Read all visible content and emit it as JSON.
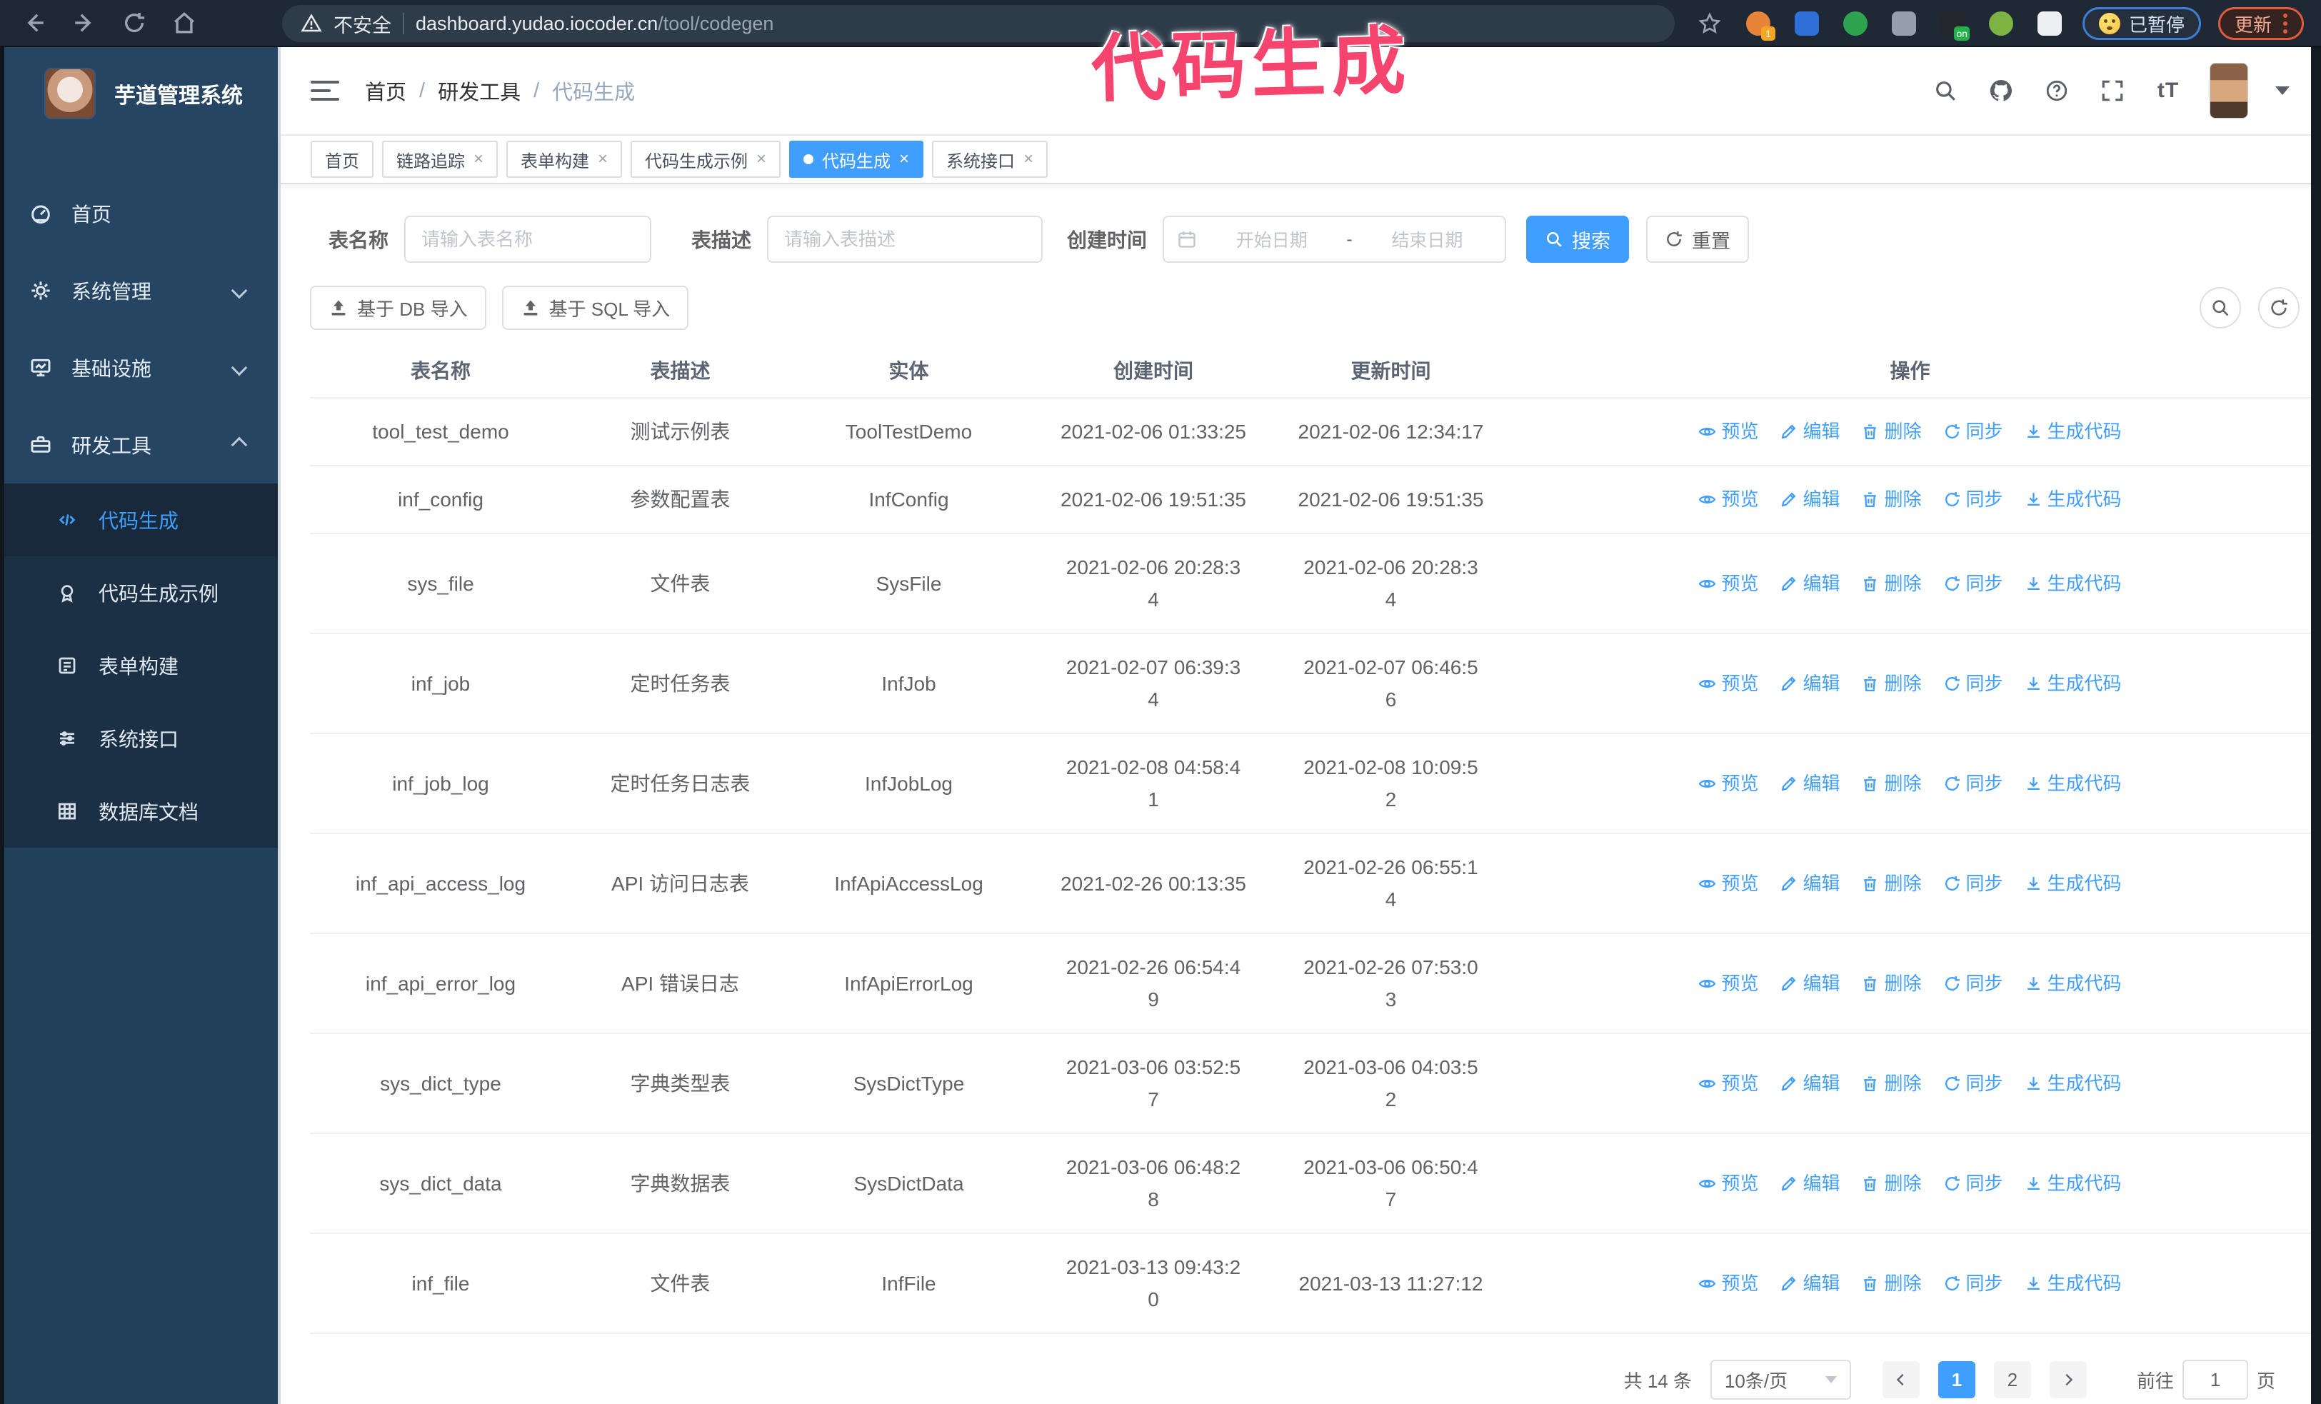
{
  "browser": {
    "insecure_label": "不安全",
    "url_host": "dashboard.yudao.iocoder.cn",
    "url_path": "/tool/codegen",
    "paused_badge": "已暂停",
    "update_button": "更新",
    "extensions": [
      {
        "name": "orange-extension-icon",
        "color": "#E8833A",
        "round": true,
        "badge": "1",
        "badge_color": "#F5A623"
      },
      {
        "name": "blue-gem-extension-icon",
        "color": "#2F6FD8",
        "round": false
      },
      {
        "name": "green-check-extension-icon",
        "color": "#2EA44F",
        "round": true
      },
      {
        "name": "grid-extension-icon",
        "color": "#95A0AC",
        "round": false
      },
      {
        "name": "dark-on-extension-icon",
        "color": "#23262B",
        "round": false,
        "badge": "on",
        "badge_color": "#24B24C"
      },
      {
        "name": "green-robot-extension-icon",
        "color": "#7CB342",
        "round": true
      },
      {
        "name": "puzzle-extension-icon",
        "color": "#EDEFF2",
        "round": false
      }
    ]
  },
  "annotation": {
    "text": "代码生成",
    "color": "#F5446E"
  },
  "sidebar": {
    "title": "芋道管理系统",
    "items": [
      {
        "label": "首页",
        "icon": "dashboard-icon",
        "type": "root"
      },
      {
        "label": "系统管理",
        "icon": "gear-icon",
        "type": "root",
        "chevron": "down"
      },
      {
        "label": "基础设施",
        "icon": "infra-icon",
        "type": "root",
        "chevron": "down"
      },
      {
        "label": "研发工具",
        "icon": "toolbox-icon",
        "type": "root",
        "chevron": "up"
      },
      {
        "label": "代码生成",
        "icon": "code-icon",
        "type": "sub",
        "active": true
      },
      {
        "label": "代码生成示例",
        "icon": "example-icon",
        "type": "sub"
      },
      {
        "label": "表单构建",
        "icon": "form-icon",
        "type": "sub"
      },
      {
        "label": "系统接口",
        "icon": "api-icon",
        "type": "sub"
      },
      {
        "label": "数据库文档",
        "icon": "database-icon",
        "type": "sub"
      }
    ]
  },
  "header": {
    "breadcrumb": [
      "首页",
      "研发工具",
      "代码生成"
    ]
  },
  "tabs": [
    {
      "label": "首页",
      "closable": false,
      "active": false
    },
    {
      "label": "链路追踪",
      "closable": true,
      "active": false
    },
    {
      "label": "表单构建",
      "closable": true,
      "active": false
    },
    {
      "label": "代码生成示例",
      "closable": true,
      "active": false
    },
    {
      "label": "代码生成",
      "closable": true,
      "active": true
    },
    {
      "label": "系统接口",
      "closable": true,
      "active": false
    }
  ],
  "filters": {
    "name_label": "表名称",
    "name_placeholder": "请输入表名称",
    "desc_label": "表描述",
    "desc_placeholder": "请输入表描述",
    "time_label": "创建时间",
    "start_placeholder": "开始日期",
    "range_separator": "-",
    "end_placeholder": "结束日期",
    "search_button": "搜索",
    "reset_button": "重置"
  },
  "toolbar": {
    "import_db": "基于 DB 导入",
    "import_sql": "基于 SQL 导入"
  },
  "table": {
    "columns": [
      "表名称",
      "表描述",
      "实体",
      "创建时间",
      "更新时间",
      "操作"
    ],
    "actions": [
      {
        "label": "预览",
        "icon": "eye-icon"
      },
      {
        "label": "编辑",
        "icon": "edit-icon"
      },
      {
        "label": "删除",
        "icon": "delete-icon"
      },
      {
        "label": "同步",
        "icon": "sync-icon"
      },
      {
        "label": "生成代码",
        "icon": "download-icon"
      }
    ],
    "rows": [
      {
        "name": "tool_test_demo",
        "desc": "测试示例表",
        "entity": "ToolTestDemo",
        "created": [
          "2021-02-06 01:33:25"
        ],
        "updated": [
          "2021-02-06 12:34:17"
        ]
      },
      {
        "name": "inf_config",
        "desc": "参数配置表",
        "entity": "InfConfig",
        "created": [
          "2021-02-06 19:51:35"
        ],
        "updated": [
          "2021-02-06 19:51:35"
        ]
      },
      {
        "name": "sys_file",
        "desc": "文件表",
        "entity": "SysFile",
        "created": [
          "2021-02-06 20:28:3",
          "4"
        ],
        "updated": [
          "2021-02-06 20:28:3",
          "4"
        ]
      },
      {
        "name": "inf_job",
        "desc": "定时任务表",
        "entity": "InfJob",
        "created": [
          "2021-02-07 06:39:3",
          "4"
        ],
        "updated": [
          "2021-02-07 06:46:5",
          "6"
        ]
      },
      {
        "name": "inf_job_log",
        "desc": "定时任务日志表",
        "entity": "InfJobLog",
        "created": [
          "2021-02-08 04:58:4",
          "1"
        ],
        "updated": [
          "2021-02-08 10:09:5",
          "2"
        ]
      },
      {
        "name": "inf_api_access_log",
        "desc": "API 访问日志表",
        "entity": "InfApiAccessLog",
        "created": [
          "2021-02-26 00:13:35"
        ],
        "updated": [
          "2021-02-26 06:55:1",
          "4"
        ]
      },
      {
        "name": "inf_api_error_log",
        "desc": "API 错误日志",
        "entity": "InfApiErrorLog",
        "created": [
          "2021-02-26 06:54:4",
          "9"
        ],
        "updated": [
          "2021-02-26 07:53:0",
          "3"
        ]
      },
      {
        "name": "sys_dict_type",
        "desc": "字典类型表",
        "entity": "SysDictType",
        "created": [
          "2021-03-06 03:52:5",
          "7"
        ],
        "updated": [
          "2021-03-06 04:03:5",
          "2"
        ]
      },
      {
        "name": "sys_dict_data",
        "desc": "字典数据表",
        "entity": "SysDictData",
        "created": [
          "2021-03-06 06:48:2",
          "8"
        ],
        "updated": [
          "2021-03-06 06:50:4",
          "7"
        ]
      },
      {
        "name": "inf_file",
        "desc": "文件表",
        "entity": "InfFile",
        "created": [
          "2021-03-13 09:43:2",
          "0"
        ],
        "updated": [
          "2021-03-13 11:27:12"
        ]
      }
    ]
  },
  "pagination": {
    "total": "共 14 条",
    "page_size": "10条/页",
    "pages": [
      "1",
      "2"
    ],
    "active_page": "1",
    "goto_label": "前往",
    "goto_value": "1",
    "page_unit": "页"
  },
  "colors": {
    "primary": "#409EFF",
    "annotation_pink": "#F5446E",
    "sidebar_bg": "#254563",
    "submenu_bg": "#1B3044"
  }
}
